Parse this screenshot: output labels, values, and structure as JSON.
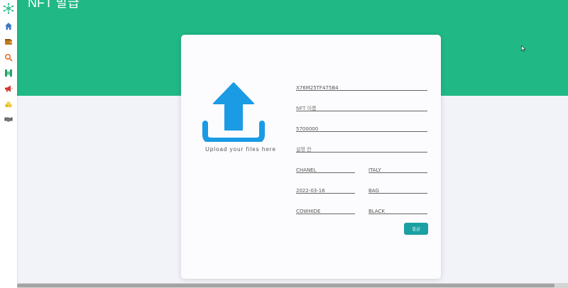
{
  "colors": {
    "header": "#20b985",
    "accent_button": "#1aa0a2",
    "upload_icon": "#1a9be4",
    "page_bg": "#f1f3f9"
  },
  "header": {
    "title": "NFT 발급"
  },
  "sidebar": {
    "logo_icon": "network-logo-icon",
    "items": [
      {
        "icon": "home-icon"
      },
      {
        "icon": "wallet-icon"
      },
      {
        "icon": "search-icon"
      },
      {
        "icon": "exchange-icon"
      },
      {
        "icon": "megaphone-icon"
      },
      {
        "icon": "coins-icon"
      },
      {
        "icon": "handshake-icon"
      }
    ]
  },
  "upload": {
    "label": "Upload your files here",
    "icon": "upload-icon"
  },
  "form": {
    "token_id": "X76M25TF475B4",
    "nft_name": "NFT 이름",
    "price": "5700000",
    "description": "설명 칸",
    "brand": "CHANEL",
    "country": "ITALY",
    "date": "2022-03-16",
    "category": "BAG",
    "material": "COWHIDE",
    "color": "BLACK"
  },
  "submit_label": "발급"
}
